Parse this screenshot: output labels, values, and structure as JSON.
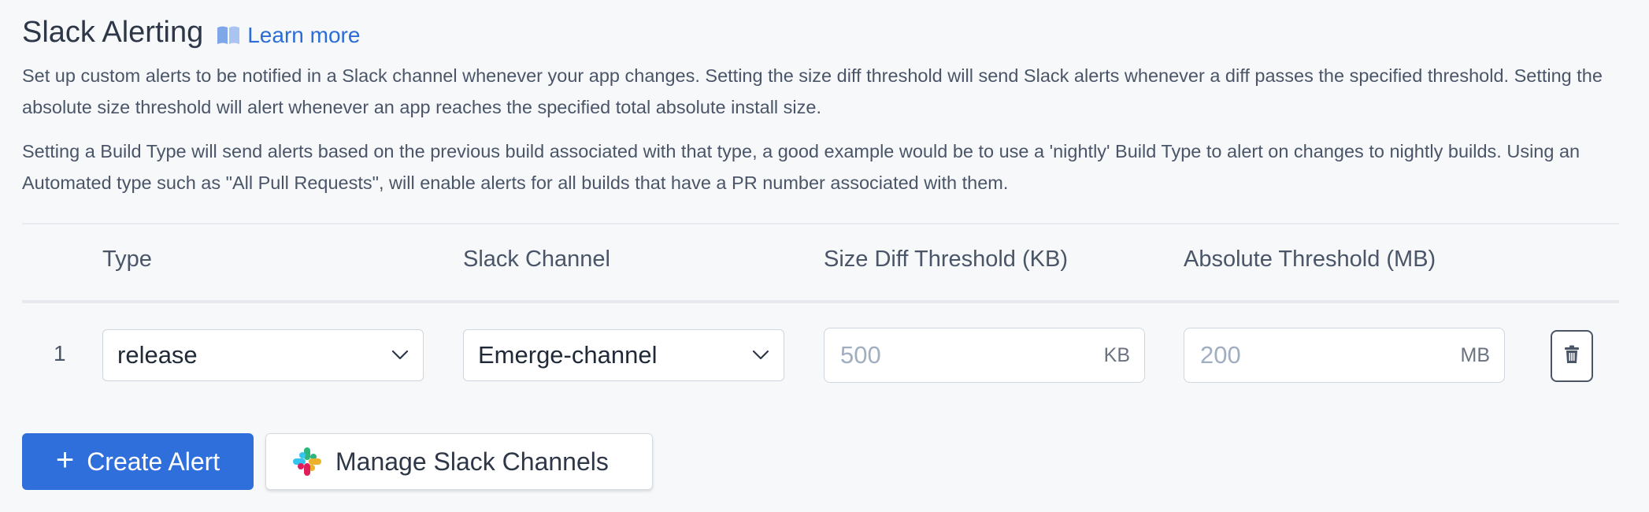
{
  "header": {
    "title": "Slack Alerting",
    "learn_more": "Learn more",
    "learn_icon": "book-icon",
    "link_color": "#2b6cd6"
  },
  "descriptions": [
    "Set up custom alerts to be notified in a Slack channel whenever your app changes. Setting the size diff threshold will send Slack alerts whenever a diff passes the specified threshold. Setting the absolute size threshold will alert whenever an app reaches the specified total absolute install size.",
    "Setting a Build Type will send alerts based on the previous build associated with that type, a good example would be to use a 'nightly' Build Type to alert on changes to nightly builds. Using an Automated type such as \"All Pull Requests\", will enable alerts for all builds that have a PR number associated with them."
  ],
  "table": {
    "columns": [
      "Type",
      "Slack Channel",
      "Size Diff Threshold (KB)",
      "Absolute Threshold (MB)"
    ],
    "rows": [
      {
        "index": "1",
        "type": "release",
        "channel": "Emerge-channel",
        "size_diff_placeholder": "500",
        "size_diff_unit": "KB",
        "absolute_placeholder": "200",
        "absolute_unit": "MB",
        "delete_icon": "trash-icon"
      }
    ]
  },
  "actions": {
    "create_label": "Create Alert",
    "create_icon": "plus-icon",
    "manage_label": "Manage Slack Channels",
    "manage_icon": "slack-logo-icon",
    "primary_color": "#2f6fdb"
  }
}
